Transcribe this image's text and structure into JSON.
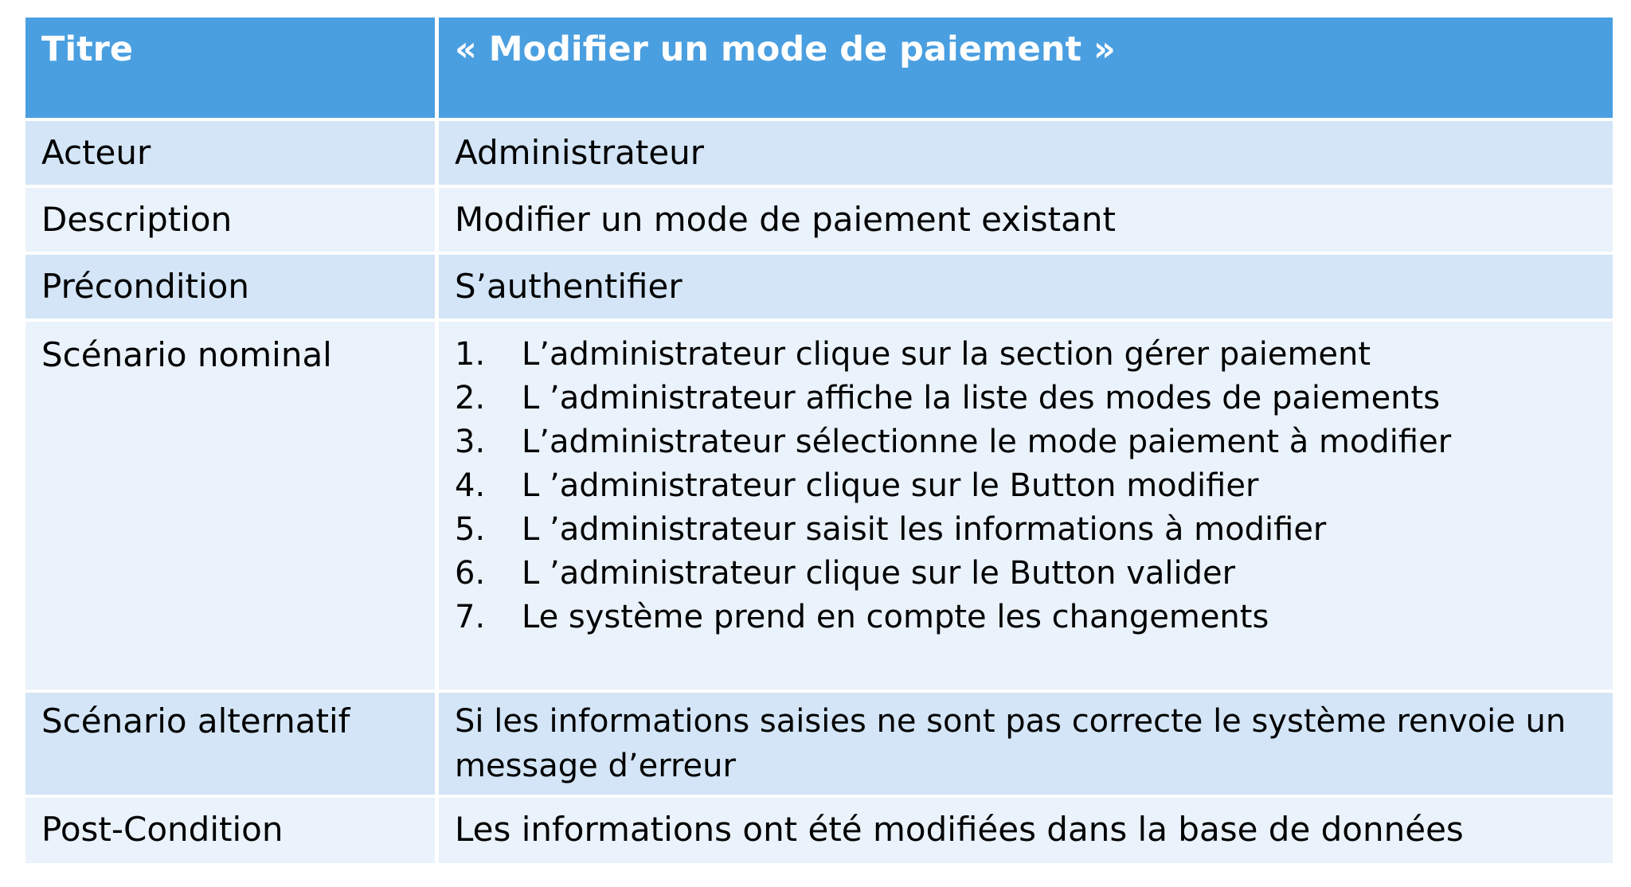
{
  "table": {
    "header": {
      "label": "Titre",
      "value": "« Modifier un mode de paiement   »"
    },
    "rows": {
      "acteur": {
        "label": "Acteur",
        "value": "Administrateur"
      },
      "description": {
        "label": "Description",
        "value": "Modifier un mode de paiement existant"
      },
      "precondition": {
        "label": "Précondition",
        "value": "S’authentifier"
      },
      "scenario_nominal": {
        "label": "Scénario nominal",
        "steps": [
          {
            "num": "1.",
            "text": "L’administrateur clique sur la section gérer paiement"
          },
          {
            "num": "2.",
            "text": "L ’administrateur affiche la liste des modes de paiements"
          },
          {
            "num": "3.",
            "text": "L’administrateur sélectionne le mode paiement à modifier"
          },
          {
            "num": "4.",
            "text": "L ’administrateur clique sur le Button modifier"
          },
          {
            "num": "5.",
            "text": "L ’administrateur saisit les informations à modifier"
          },
          {
            "num": "6.",
            "text": "L ’administrateur clique sur le Button valider"
          },
          {
            "num": "7.",
            "text": "Le système prend en compte les changements"
          }
        ]
      },
      "scenario_alternatif": {
        "label": "Scénario alternatif",
        "value": "Si les informations saisies ne sont pas correcte le système renvoie un message d’erreur"
      },
      "post_condition": {
        "label": "Post-Condition",
        "value": "Les informations ont été modifiées dans la base de données"
      }
    }
  },
  "colors": {
    "header_bg": "#4a9fe0",
    "row_dark": "#d3e5f6",
    "row_light": "#eaf2fb"
  }
}
